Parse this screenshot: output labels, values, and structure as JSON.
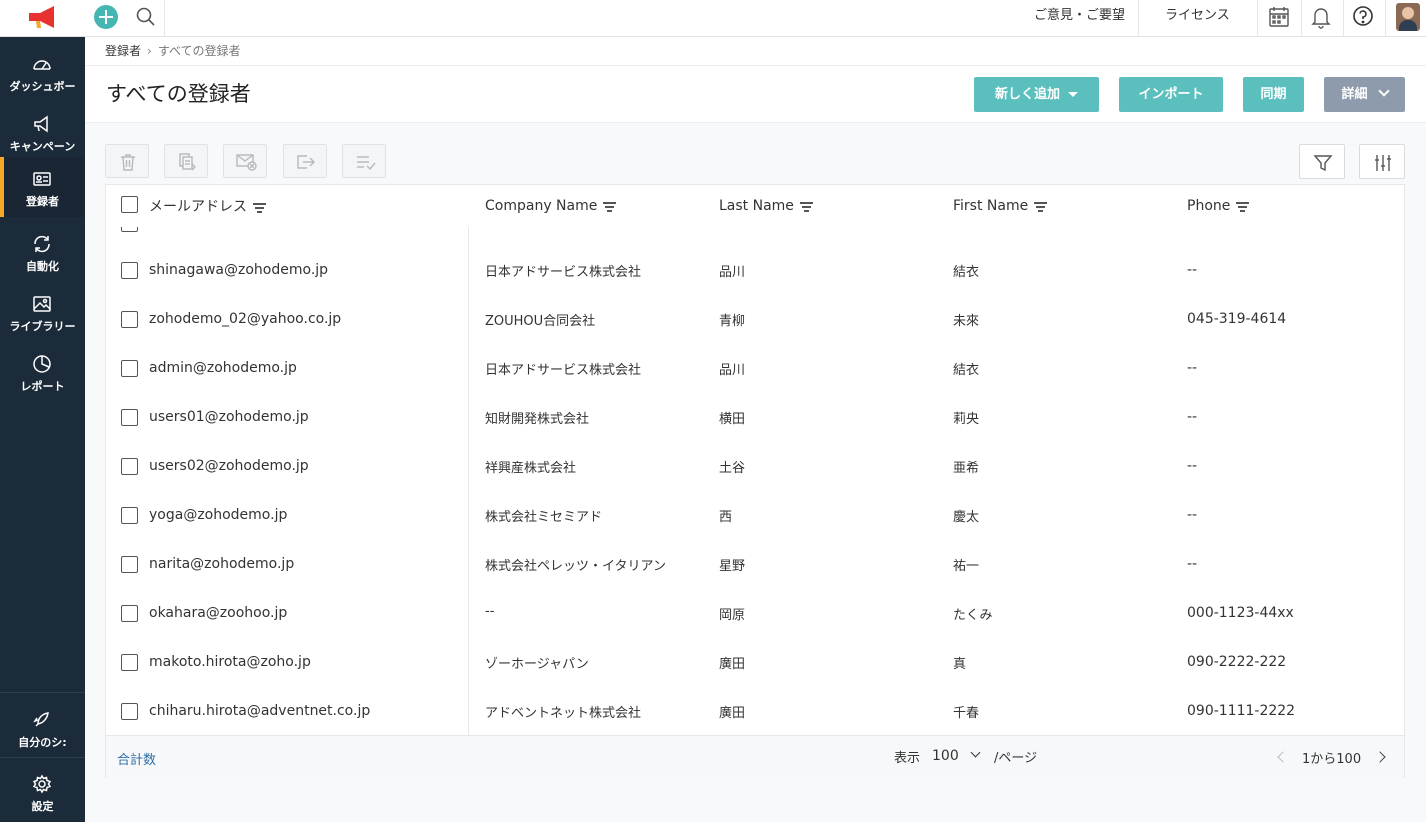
{
  "sidebar": {
    "items": [
      {
        "label": "ダッシュボー",
        "icon": "dashboard-gauge-icon"
      },
      {
        "label": "キャンペーン",
        "icon": "megaphone-icon"
      },
      {
        "label": "登録者",
        "icon": "contact-card-icon"
      },
      {
        "label": "自動化",
        "icon": "automation-cycle-icon"
      },
      {
        "label": "ライブラリー",
        "icon": "image-library-icon"
      },
      {
        "label": "レポート",
        "icon": "pie-chart-icon"
      }
    ],
    "bottom": [
      {
        "label": "自分のシ:",
        "icon": "rocket-icon"
      },
      {
        "label": "設定",
        "icon": "gear-icon"
      }
    ],
    "active_index": 2,
    "accent": "#f4a823"
  },
  "topbar": {
    "feedback": "ご意見・ご要望",
    "license": "ライセンス"
  },
  "breadcrumb": {
    "parent": "登録者",
    "separator": "›",
    "current": "すべての登録者"
  },
  "page": {
    "title": "すべての登録者"
  },
  "actions": {
    "add_new": "新しく追加",
    "import": "インポート",
    "sync": "同期",
    "details": "詳細"
  },
  "colors": {
    "teal": "#5bbfbd",
    "gray_button": "#8d9bad",
    "sidebar": "#1c2b3a",
    "link": "#2f6fa8"
  },
  "table": {
    "columns": [
      "メールアドレス",
      "Company Name",
      "Last Name",
      "First Name",
      "Phone"
    ],
    "rows": [
      {
        "email": "shinagawa@zohodemo.jp",
        "company": "日本アドサービス株式会社",
        "last": "品川",
        "first": "結衣",
        "phone": "--"
      },
      {
        "email": "zohodemo_02@yahoo.co.jp",
        "company": "ZOUHOU合同会社",
        "last": "青柳",
        "first": "未來",
        "phone": "045-319-4614"
      },
      {
        "email": "admin@zohodemo.jp",
        "company": "日本アドサービス株式会社",
        "last": "品川",
        "first": "結衣",
        "phone": "--"
      },
      {
        "email": "users01@zohodemo.jp",
        "company": "知財開発株式会社",
        "last": "横田",
        "first": "莉央",
        "phone": "--"
      },
      {
        "email": "users02@zohodemo.jp",
        "company": "祥興産株式会社",
        "last": "土谷",
        "first": "亜希",
        "phone": "--"
      },
      {
        "email": "yoga@zohodemo.jp",
        "company": "株式会社ミセミアド",
        "last": "西",
        "first": "慶太",
        "phone": "--"
      },
      {
        "email": "narita@zohodemo.jp",
        "company": "株式会社ペレッツ・イタリアン",
        "last": "星野",
        "first": "祐一",
        "phone": "--"
      },
      {
        "email": "okahara@zoohoo.jp",
        "company": "--",
        "last": "岡原",
        "first": "たくみ",
        "phone": "000-1123-44xx"
      },
      {
        "email": "makoto.hirota@zoho.jp",
        "company": "ゾーホージャパン",
        "last": "廣田",
        "first": "真",
        "phone": "090-2222-222"
      },
      {
        "email": "chiharu.hirota@adventnet.co.jp",
        "company": "アドベントネット株式会社",
        "last": "廣田",
        "first": "千春",
        "phone": "090-1111-2222"
      }
    ]
  },
  "footer": {
    "total": "合計数",
    "show": "表示",
    "per_page_value": "100",
    "per_page": "/ページ",
    "range": "1から100"
  }
}
